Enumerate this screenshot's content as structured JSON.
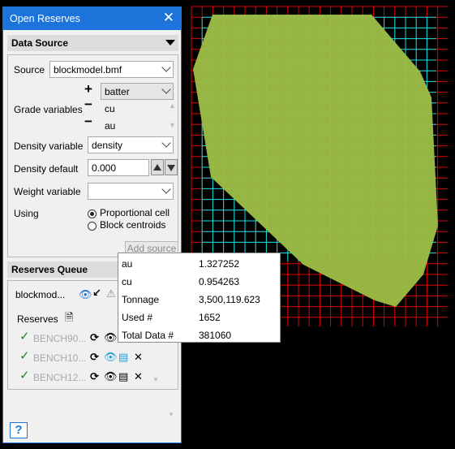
{
  "dialog": {
    "title": "Open Reserves",
    "close_icon": "close-icon"
  },
  "data_source": {
    "header": "Data Source",
    "source_label": "Source",
    "source_value": "blockmodel.bmf",
    "grade_variables_label": "Grade variables",
    "grade_add_value": "batter",
    "grade_variables": [
      "cu",
      "au"
    ],
    "density_variable_label": "Density variable",
    "density_variable_value": "density",
    "density_default_label": "Density default",
    "density_default_value": "0.000",
    "weight_variable_label": "Weight variable",
    "weight_variable_value": "",
    "using_label": "Using",
    "using_options": [
      "Proportional cell",
      "Block centroids"
    ],
    "using_selected": "Proportional cell",
    "add_source_label": "Add source"
  },
  "reserves_queue": {
    "header": "Reserves Queue",
    "model_name": "blockmod...",
    "reserves_label": "Reserves",
    "benches": [
      "BENCH90...",
      "BENCH10...",
      "BENCH12..."
    ]
  },
  "tooltip": {
    "rows": [
      {
        "key": "au",
        "value": "1.327252"
      },
      {
        "key": "cu",
        "value": "0.954263"
      },
      {
        "key": "Tonnage",
        "value": "3,500,119.623"
      },
      {
        "key": "Used #",
        "value": "1652"
      },
      {
        "key": "Total Data #",
        "value": "381060"
      }
    ]
  },
  "help_label": "?",
  "colors": {
    "accent": "#1c73d9",
    "grid_inner": "#00e5e5",
    "grid_outer": "#e00000",
    "polygon_fill": "#9bbb45",
    "check": "#1c8a1c"
  }
}
